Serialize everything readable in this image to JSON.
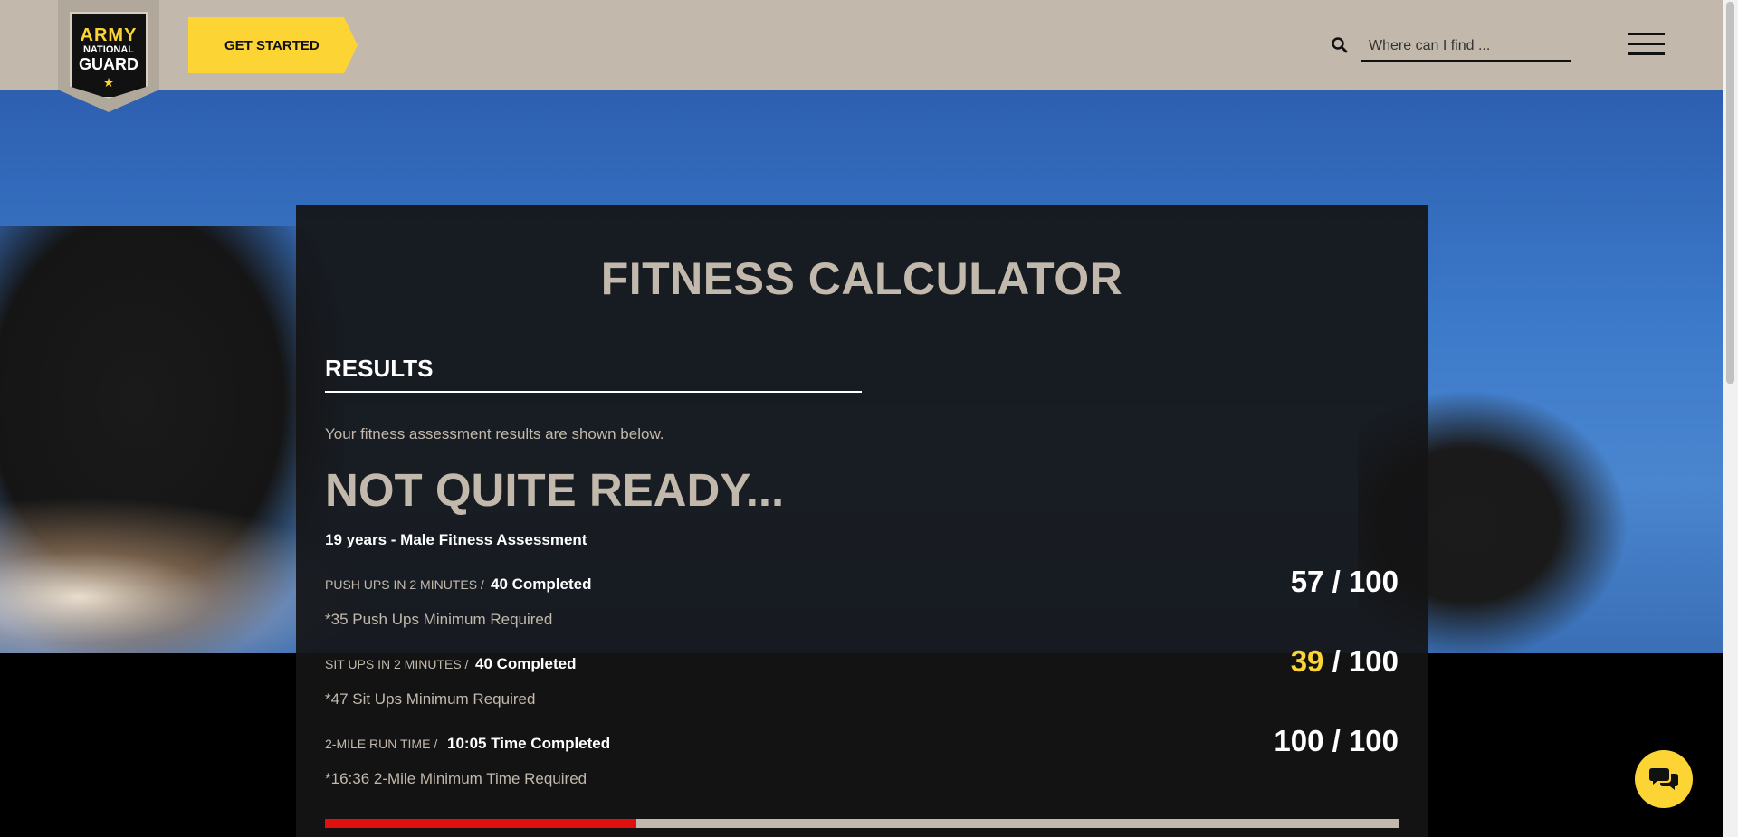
{
  "header": {
    "logo": {
      "line1": "ARMY",
      "line2": "NATIONAL",
      "line3": "GUARD"
    },
    "get_started_label": "GET STARTED",
    "search": {
      "placeholder": "Where can I find ..."
    }
  },
  "calculator": {
    "title": "FITNESS CALCULATOR",
    "results_heading": "RESULTS",
    "intro": "Your fitness assessment results are shown below.",
    "status": "NOT QUITE READY...",
    "assessment": "19 years - Male Fitness Assessment",
    "rows": [
      {
        "label": "PUSH UPS IN 2 MINUTES /",
        "value": "40 Completed",
        "minimum": "*35 Push Ups Minimum Required",
        "score": "57",
        "total": " / 100",
        "score_color": "#ffffff"
      },
      {
        "label": "SIT UPS IN 2 MINUTES /",
        "value": "40 Completed",
        "minimum": "*47 Sit Ups Minimum Required",
        "score": "39",
        "total": " / 100",
        "score_color": "#fcd535"
      },
      {
        "label": "2-MILE RUN TIME /",
        "value": "10:05 Time Completed",
        "minimum": "*16:36 2-Mile Minimum Time Required",
        "score": "100",
        "total": " / 100",
        "score_color": "#ffffff"
      }
    ],
    "progress": 0.29
  },
  "colors": {
    "header_bg": "#c2b9ac",
    "accent_yellow": "#fcd535",
    "progress_red": "#e01010",
    "card_bg": "#141416"
  },
  "icons": [
    "search-icon",
    "menu-icon",
    "chat-icon",
    "star-icon"
  ]
}
